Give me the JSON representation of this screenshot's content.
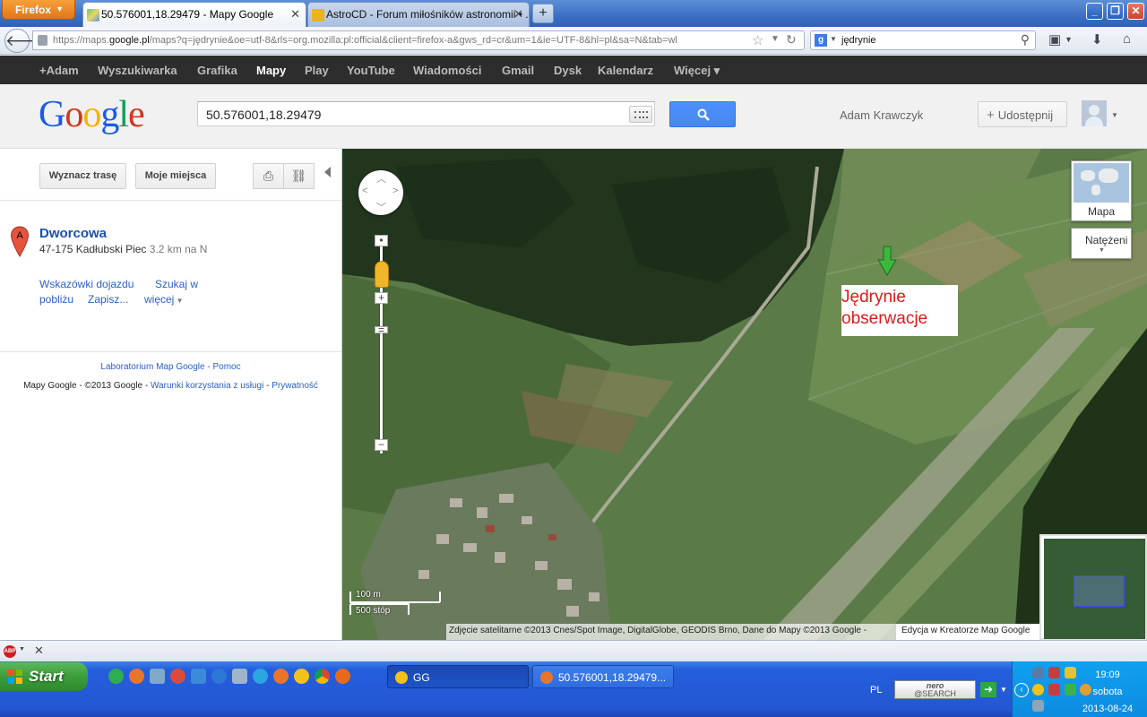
{
  "browser": {
    "menu_button": "Firefox",
    "tabs": [
      {
        "title": "50.576001,18.29479 - Mapy Google",
        "active": true
      },
      {
        "title": "AstroCD - Forum miłośników astronomii • ...",
        "active": false
      }
    ],
    "new_tab": "+",
    "url_prefix": "https://maps.",
    "url_domain": "google.pl",
    "url_rest": "/maps?q=jędrynie&oe=utf-8&rls=org.mozilla:pl:official&client=firefox-a&gws_rd=cr&um=1&ie=UTF-8&hl=pl&sa=N&tab=wl",
    "search_value": "jędrynie"
  },
  "google_bar": {
    "items": [
      "+Adam",
      "Wyszukiwarka",
      "Grafika",
      "Mapy",
      "Play",
      "YouTube",
      "Wiadomości",
      "Gmail",
      "Dysk",
      "Kalendarz",
      "Więcej ▾"
    ],
    "active_index": 3
  },
  "header": {
    "logo": [
      "G",
      "o",
      "o",
      "g",
      "l",
      "e"
    ],
    "query": "50.576001,18.29479",
    "user_name": "Adam Krawczyk",
    "share_label": "Udostępnij",
    "share_plus": "+"
  },
  "left_panel": {
    "route_button": "Wyznacz trasę",
    "places_button": "Moje miejsca",
    "result": {
      "marker_letter": "A",
      "title": "Dworcowa",
      "address": "47-175 Kadłubski Piec",
      "distance": "3.2 km na N"
    },
    "links": {
      "directions": "Wskazówki dojazdu",
      "search_line1": "Szukaj w",
      "search_line2": "pobliżu",
      "save": "Zapisz...",
      "more": "więcej"
    },
    "footer": {
      "lab": "Laboratorium Map Google",
      "sep": " - ",
      "help": "Pomoc",
      "copyright": "Mapy Google - ©2013 Google - ",
      "terms": "Warunki korzystania z usługi",
      "privacy": "Prywatność"
    }
  },
  "map": {
    "map_type_label": "Mapa",
    "overlay_label": "Natężeni",
    "note_line1": "Jędrynie",
    "note_line2": "obserwacje",
    "scale_metric": "100 m",
    "scale_imperial": "500 stóp",
    "attribution": "Zdjęcie satelitarne ©2013 Cnes/Spot Image, DigitalGlobe, GEODIS Brno, Dane do Mapy ©2013 Google -",
    "kreator": "Edycja w Kreatorze Map Google",
    "zoom_in": "+",
    "zoom_out": "−"
  },
  "taskbar": {
    "start": "Start",
    "windows": [
      "GG",
      "50.576001,18.29479..."
    ],
    "language": "PL",
    "nero_line1": "nero",
    "nero_line2": "@SEARCH",
    "time": "19:09",
    "day": "sobota",
    "date": "2013-08-24"
  },
  "colors": {
    "google_blue": "#1c5be6",
    "search_button": "#4d90fe",
    "note_red": "#e01818",
    "marker_green": "#3db83d",
    "taskbar_blue": "#245edc"
  }
}
